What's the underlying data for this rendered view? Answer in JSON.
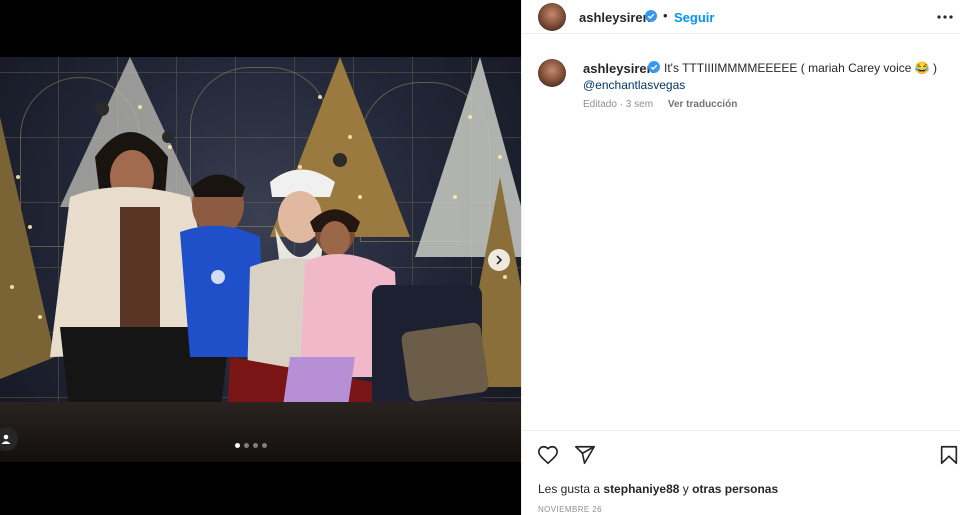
{
  "post": {
    "username": "ashleysiren",
    "follow_label": "Seguir",
    "separator": "•",
    "caption_text": "It's TTTIIIIMMMMEEEEE ( mariah Carey voice 😂 )",
    "caption_mention": "@enchantlasvegas",
    "edited_label": "Editado · 3 sem",
    "translate_label": "Ver traducción",
    "likes_prefix": "Les gusta a ",
    "likes_user": "stephaniye88",
    "likes_middle": " y ",
    "likes_others": "otras personas",
    "date": "NOVIEMBRE 26"
  },
  "carousel": {
    "total_slides": 4,
    "active_slide": 1
  },
  "icons": {
    "verified": "verified-badge-icon",
    "more": "more-options-icon",
    "like": "heart-icon",
    "share": "share-paper-plane-icon",
    "save": "bookmark-icon",
    "next": "chevron-right-icon",
    "tags": "user-tag-icon"
  },
  "colors": {
    "accent": "#0095f6",
    "verified": "#3897f0",
    "text": "#262626",
    "muted": "#8e8e8e",
    "mention": "#00376b"
  }
}
